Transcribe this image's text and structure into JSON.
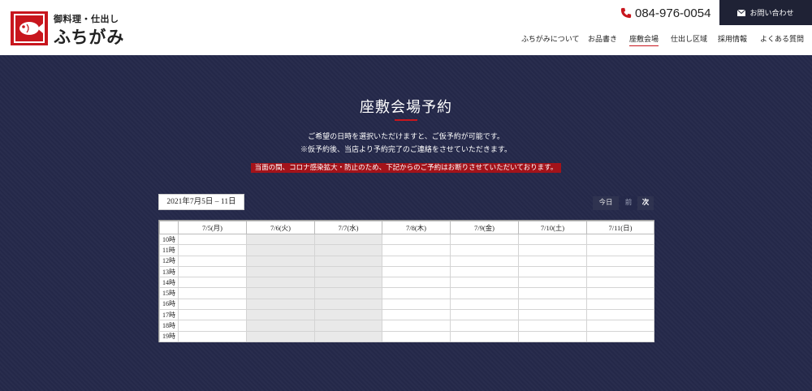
{
  "header": {
    "logo_small": "御料理・仕出し",
    "logo_large": "ふちがみ",
    "phone": "084-976-0054",
    "contact_label": "お問い合わせ",
    "nav": [
      {
        "label": "ふちがみについて",
        "active": false
      },
      {
        "label": "お品書き",
        "active": false
      },
      {
        "label": "座敷会場",
        "active": true
      },
      {
        "label": "仕出し区域",
        "active": false
      },
      {
        "label": "採用情報",
        "active": false
      },
      {
        "label": "よくある質問",
        "active": false
      }
    ]
  },
  "main": {
    "title": "座敷会場予約",
    "description_line1": "ご希望の日時を選択いただけますと、ご仮予約が可能です。",
    "description_line2": "※仮予約後、当店より予約完了のご連絡をさせていただきます。",
    "notice": "当面の間、コロナ感染拡大・防止のため、下記からのご予約はお断りさせていただいております。"
  },
  "calendar": {
    "date_range": "2021年7月5日 – 11日",
    "today_label": "今日",
    "prev_label": "前",
    "next_label": "次",
    "days": [
      "7/5(月)",
      "7/6(火)",
      "7/7(水)",
      "7/8(木)",
      "7/9(金)",
      "7/10(土)",
      "7/11(日)"
    ],
    "closed_days": [
      1,
      2
    ],
    "hours": [
      "10時",
      "11時",
      "12時",
      "13時",
      "14時",
      "15時",
      "16時",
      "17時",
      "18時",
      "19時"
    ]
  },
  "colors": {
    "accent": "#c8161d",
    "navy": "#25294a",
    "header_button": "#1f2235",
    "closed_cell": "#e9e9e9"
  },
  "icons": {
    "logo": "fish-logo-icon",
    "phone": "phone-icon",
    "mail": "mail-icon"
  }
}
